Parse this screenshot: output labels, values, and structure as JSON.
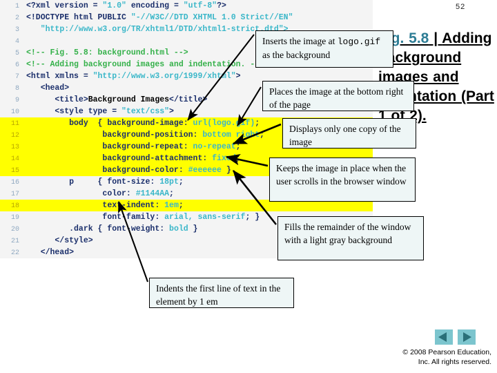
{
  "slide": {
    "page_number": "52",
    "figure_title_prefix": "Fig. 5.8",
    "figure_title_separator": " | ",
    "figure_title_rest": "Adding background images and indentation (Part 1 of 2)."
  },
  "code": {
    "lines": [
      {
        "n": "1",
        "highlight": false,
        "tokens": [
          {
            "t": "<?xml version = ",
            "c": "nav"
          },
          {
            "t": "\"1.0\"",
            "c": "str"
          },
          {
            "t": " encoding = ",
            "c": "nav"
          },
          {
            "t": "\"utf-8\"",
            "c": "str"
          },
          {
            "t": "?>",
            "c": "nav"
          }
        ]
      },
      {
        "n": "2",
        "highlight": false,
        "tokens": [
          {
            "t": "<!DOCTYPE html PUBLIC ",
            "c": "nav"
          },
          {
            "t": "\"-//W3C//DTD XHTML 1.0 Strict//EN\"",
            "c": "str"
          }
        ]
      },
      {
        "n": "3",
        "highlight": false,
        "tokens": [
          {
            "t": "   ",
            "c": "nav"
          },
          {
            "t": "\"http://www.w3.org/TR/xhtml1/DTD/xhtml1-strict.dtd\">",
            "c": "str"
          }
        ]
      },
      {
        "n": "4",
        "highlight": false,
        "tokens": [
          {
            "t": "",
            "c": "nav"
          }
        ]
      },
      {
        "n": "5",
        "highlight": false,
        "tokens": [
          {
            "t": "<!-- Fig. 5.8: background.html -->",
            "c": "cmt"
          }
        ]
      },
      {
        "n": "6",
        "highlight": false,
        "tokens": [
          {
            "t": "<!-- Adding background images and indentation. -->",
            "c": "cmt"
          }
        ]
      },
      {
        "n": "7",
        "highlight": false,
        "tokens": [
          {
            "t": "<html xmlns = ",
            "c": "nav"
          },
          {
            "t": "\"http://www.w3.org/1999/xhtml\"",
            "c": "str"
          },
          {
            "t": ">",
            "c": "nav"
          }
        ]
      },
      {
        "n": "8",
        "highlight": false,
        "tokens": [
          {
            "t": "   <head>",
            "c": "nav"
          }
        ]
      },
      {
        "n": "9",
        "highlight": false,
        "tokens": [
          {
            "t": "      <title>",
            "c": "nav"
          },
          {
            "t": "Background Images",
            "c": "txt"
          },
          {
            "t": "</title>",
            "c": "nav"
          }
        ]
      },
      {
        "n": "10",
        "highlight": false,
        "tokens": [
          {
            "t": "      <style type = ",
            "c": "nav"
          },
          {
            "t": "\"text/css\"",
            "c": "str"
          },
          {
            "t": ">",
            "c": "nav"
          }
        ]
      },
      {
        "n": "11",
        "highlight": true,
        "tokens": [
          {
            "t": "         body  { background-image: ",
            "c": "nav"
          },
          {
            "t": "url(logo.gif)",
            "c": "val"
          },
          {
            "t": ";",
            "c": "nav"
          }
        ]
      },
      {
        "n": "12",
        "highlight": true,
        "tokens": [
          {
            "t": "                background-position: ",
            "c": "nav"
          },
          {
            "t": "bottom right",
            "c": "val"
          },
          {
            "t": ";",
            "c": "nav"
          }
        ]
      },
      {
        "n": "13",
        "highlight": true,
        "tokens": [
          {
            "t": "                background-repeat: ",
            "c": "nav"
          },
          {
            "t": "no-repeat",
            "c": "val"
          },
          {
            "t": ";",
            "c": "nav"
          }
        ]
      },
      {
        "n": "14",
        "highlight": true,
        "tokens": [
          {
            "t": "                background-attachment: ",
            "c": "nav"
          },
          {
            "t": "fixed",
            "c": "val"
          },
          {
            "t": ";",
            "c": "nav"
          }
        ]
      },
      {
        "n": "15",
        "highlight": true,
        "tokens": [
          {
            "t": "                background-color: ",
            "c": "nav"
          },
          {
            "t": "#eeeeee",
            "c": "val"
          },
          {
            "t": " }",
            "c": "nav"
          }
        ]
      },
      {
        "n": "16",
        "highlight": false,
        "tokens": [
          {
            "t": "         p     { font-size: ",
            "c": "nav"
          },
          {
            "t": "18pt",
            "c": "val"
          },
          {
            "t": ";",
            "c": "nav"
          }
        ]
      },
      {
        "n": "17",
        "highlight": false,
        "tokens": [
          {
            "t": "                color: ",
            "c": "nav"
          },
          {
            "t": "#1144AA",
            "c": "val"
          },
          {
            "t": ";",
            "c": "nav"
          }
        ]
      },
      {
        "n": "18",
        "highlight": true,
        "tokens": [
          {
            "t": "                text-indent: ",
            "c": "nav"
          },
          {
            "t": "1em",
            "c": "val"
          },
          {
            "t": ";",
            "c": "nav"
          }
        ]
      },
      {
        "n": "19",
        "highlight": false,
        "tokens": [
          {
            "t": "                font-family: ",
            "c": "nav"
          },
          {
            "t": "arial, sans-serif",
            "c": "val"
          },
          {
            "t": "; }",
            "c": "nav"
          }
        ]
      },
      {
        "n": "20",
        "highlight": false,
        "tokens": [
          {
            "t": "         .dark { font-weight: ",
            "c": "nav"
          },
          {
            "t": "bold",
            "c": "val"
          },
          {
            "t": " }",
            "c": "nav"
          }
        ]
      },
      {
        "n": "21",
        "highlight": false,
        "tokens": [
          {
            "t": "      </style>",
            "c": "nav"
          }
        ]
      },
      {
        "n": "22",
        "highlight": false,
        "tokens": [
          {
            "t": "   </head>",
            "c": "nav"
          }
        ]
      }
    ]
  },
  "callouts": [
    {
      "id": "callout-1",
      "name": "callout-background-image",
      "parts": [
        {
          "t": "Inserts the image at ",
          "mono": false
        },
        {
          "t": "logo.gif",
          "mono": true
        },
        {
          "t": " as the background",
          "mono": false
        }
      ]
    },
    {
      "id": "callout-2",
      "name": "callout-background-position",
      "parts": [
        {
          "t": "Places the image at the bottom right of the page",
          "mono": false
        }
      ]
    },
    {
      "id": "callout-3",
      "name": "callout-background-repeat",
      "parts": [
        {
          "t": "Displays only one copy of the image",
          "mono": false
        }
      ]
    },
    {
      "id": "callout-4",
      "name": "callout-background-attachment",
      "parts": [
        {
          "t": "Keeps the image in place when the user scrolls in the browser window",
          "mono": false
        }
      ]
    },
    {
      "id": "callout-5",
      "name": "callout-background-color",
      "parts": [
        {
          "t": "Fills the remainder of the window with a light gray background",
          "mono": false
        }
      ]
    },
    {
      "id": "callout-6",
      "name": "callout-text-indent",
      "parts": [
        {
          "t": "Indents the first line of text in the element by 1 em",
          "mono": false
        }
      ]
    }
  ],
  "footer": {
    "prev_label": "previous-slide",
    "next_label": "next-slide",
    "copyright_line1": "© 2008 Pearson Education,",
    "copyright_line2": "Inc.  All rights reserved."
  },
  "colors": {
    "highlight": "#ffff00",
    "code_bg": "#f4f4f4",
    "callout_bg": "#eef6f6",
    "nav_button": "#7cc5ce",
    "nav_arrow": "#2a6f78",
    "fig_accent": "#2e7d95"
  }
}
